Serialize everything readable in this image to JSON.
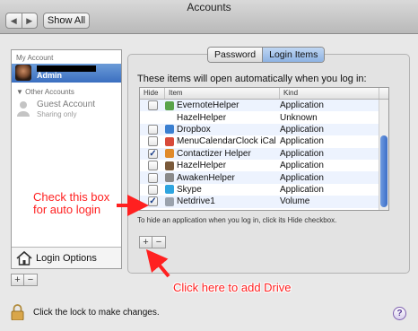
{
  "window": {
    "title": "Accounts"
  },
  "toolbar": {
    "back_label": "◀",
    "forward_label": "▶",
    "show_all_label": "Show All"
  },
  "sidebar": {
    "my_account_header": "My Account",
    "admin_label": "Admin",
    "other_accounts_header": "▼ Other Accounts",
    "guest_name": "Guest Account",
    "guest_sub": "Sharing only",
    "login_options_label": "Login Options",
    "add_label": "+",
    "remove_label": "−"
  },
  "tabs": [
    "Password",
    "Login Items"
  ],
  "pane": {
    "intro": "These items will open automatically when you log in:",
    "columns": {
      "hide": "Hide",
      "item": "Item",
      "kind": "Kind"
    },
    "hint": "To hide an application when you log in, click its Hide checkbox.",
    "add_label": "+",
    "remove_label": "−"
  },
  "login_items": [
    {
      "name": "EvernoteHelper",
      "kind": "Application",
      "hidden": false,
      "has_checkbox": true,
      "icon": "evernote-icon",
      "color": "#5aa34a"
    },
    {
      "name": "HazelHelper",
      "kind": "Unknown",
      "hidden": false,
      "has_checkbox": false,
      "icon": "",
      "color": ""
    },
    {
      "name": "Dropbox",
      "kind": "Application",
      "hidden": false,
      "has_checkbox": true,
      "icon": "dropbox-icon",
      "color": "#3a7fd0"
    },
    {
      "name": "MenuCalendarClock iCal",
      "kind": "Application",
      "hidden": false,
      "has_checkbox": true,
      "icon": "calendar-icon",
      "color": "#d84a3a"
    },
    {
      "name": "Contactizer Helper",
      "kind": "Application",
      "hidden": true,
      "has_checkbox": true,
      "icon": "contactizer-icon",
      "color": "#e08a2a"
    },
    {
      "name": "HazelHelper",
      "kind": "Application",
      "hidden": false,
      "has_checkbox": true,
      "icon": "hazel-icon",
      "color": "#7a5a3a"
    },
    {
      "name": "AwakenHelper",
      "kind": "Application",
      "hidden": false,
      "has_checkbox": true,
      "icon": "awaken-icon",
      "color": "#8a8a8a"
    },
    {
      "name": "Skype",
      "kind": "Application",
      "hidden": false,
      "has_checkbox": true,
      "icon": "skype-icon",
      "color": "#2fa5e0"
    },
    {
      "name": "Netdrive1",
      "kind": "Volume",
      "hidden": true,
      "has_checkbox": true,
      "icon": "drive-icon",
      "color": "#9aa2ad"
    }
  ],
  "footer": {
    "lock_text": "Click the lock to make changes.",
    "help_label": "?"
  },
  "annotations": {
    "check_box_lines": [
      "Check this box",
      "for auto login"
    ],
    "add_drive": "Click here to add Drive",
    "color": "#ff2020"
  }
}
